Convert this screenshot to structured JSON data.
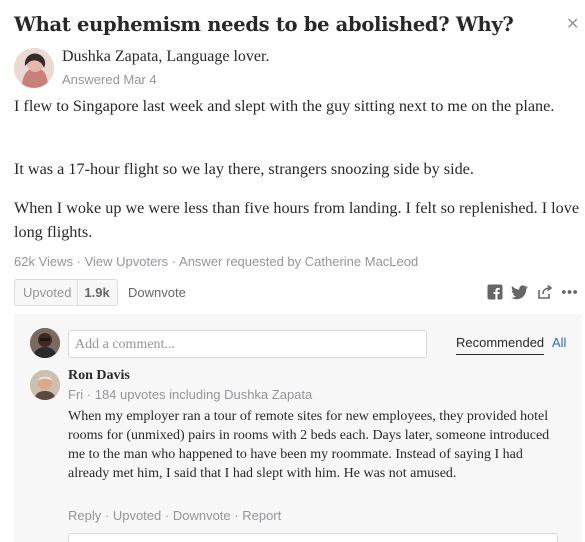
{
  "question": {
    "title": "What euphemism needs to be abolished? Why?"
  },
  "answer": {
    "author_line": "Dushka Zapata, Language lover.",
    "answered": "Answered Mar 4",
    "paragraphs": [
      "I flew to Singapore last week and slept with the guy sitting next to me on the plane.",
      "It was a 17-hour flight so we lay there, strangers snoozing side by side.",
      "When I woke up we were less than five hours from landing. I felt so replenished. I love long flights."
    ],
    "views": "62k Views",
    "view_upvoters": "View Upvoters",
    "requested": "Answer requested by Catherine MacLeod",
    "upvote_label": "Upvoted",
    "upvote_count": "1.9k",
    "downvote_label": "Downvote"
  },
  "comments": {
    "input_placeholder": "Add a comment...",
    "tab_recommended": "Recommended",
    "tab_all": "All",
    "items": [
      {
        "author": "Ron Davis",
        "meta": "Fri · 184 upvotes including Dushka Zapata",
        "body": "When my employer ran a tour of remote sites for new employees, they provided hotel rooms for (unmixed) pairs in rooms with 2 beds each. Days later, someone introduced me to the man who happened to have been my roommate. Instead of saying I had already met him, I said that I had slept with him. He was not amused.",
        "reply": "Reply",
        "upvoted": "Upvoted",
        "downvote": "Downvote",
        "report": "Report"
      }
    ]
  },
  "icons": [
    "close-icon",
    "facebook-icon",
    "twitter-icon",
    "share-icon",
    "more-icon"
  ],
  "colors": {
    "link": "#2b6dad",
    "muted": "#939598",
    "text": "#282829",
    "panel": "#f7f7f7"
  }
}
